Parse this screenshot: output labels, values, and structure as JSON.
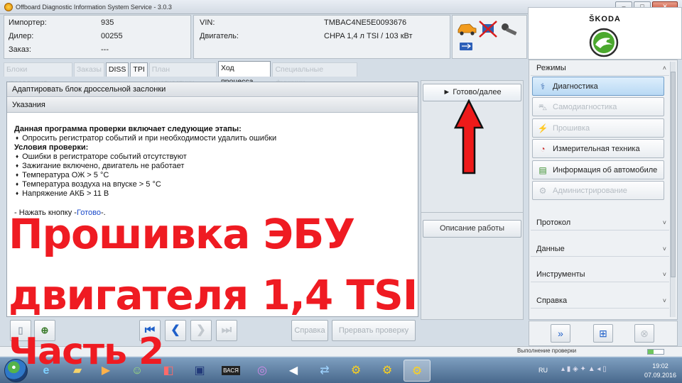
{
  "window": {
    "title": "Offboard Diagnostic Information System Service - 3.0.3"
  },
  "titlebar_buttons": {
    "minimize": "–",
    "maximize": "□",
    "close": "✕"
  },
  "vehicle_info": {
    "importer_label": "Импортер:",
    "importer_value": "935",
    "dealer_label": "Дилер:",
    "dealer_value": "00255",
    "order_label": "Заказ:",
    "order_value": "---",
    "vin_label": "VIN:",
    "vin_value": "TMBAC4NE5E0093676",
    "engine_label": "Двигатель:",
    "engine_value": "CHPA 1,4 л TSI / 103 кВт"
  },
  "brand": {
    "name": "ŠKODA"
  },
  "tabs": [
    {
      "label": "Блоки управления",
      "state": "disabled"
    },
    {
      "label": "Заказы",
      "state": "disabled"
    },
    {
      "label": "DISS",
      "state": "enabled"
    },
    {
      "label": "TPI",
      "state": "enabled"
    },
    {
      "label": "План диагностики",
      "state": "disabled"
    },
    {
      "label": "Ход процесса",
      "state": "active"
    },
    {
      "label": "Специальные функции",
      "state": "disabled"
    }
  ],
  "content": {
    "step_title": "Адаптировать блок дроссельной заслонки",
    "section_title": "Указания",
    "heading1": "Данная программа проверки включает следующие этапы:",
    "item1": "Опросить регистратор событий и при необходимости удалить ошибки",
    "heading2": "Условия проверки:",
    "conditions": [
      "Ошибки в регистраторе событий отсутствуют",
      "Зажигание включено, двигатель не работает",
      "Температура ОЖ > 5 °C",
      "Температура воздуха на впуске > 5 °C",
      "Напряжение АКБ > 11 В"
    ],
    "press_prefix": "- Нажать кнопку -",
    "press_link": "Готово",
    "press_suffix": "-."
  },
  "side_buttons": {
    "ready": "► Готово/далее",
    "work_description": "Описание работы"
  },
  "bottom_buttons": {
    "help": "Справка",
    "abort": "Прервать проверку"
  },
  "modes": {
    "header": "Режимы",
    "items": [
      {
        "label": "Диагностика",
        "icon": "stethoscope-icon",
        "state": "selected"
      },
      {
        "label": "Самодиагностика",
        "icon": "car-icon",
        "state": "disabled"
      },
      {
        "label": "Прошивка",
        "icon": "flash-icon",
        "state": "disabled"
      },
      {
        "label": "Измерительная техника",
        "icon": "gauge-icon",
        "state": "enabled"
      },
      {
        "label": "Информация об автомобиле",
        "icon": "books-icon",
        "state": "enabled"
      },
      {
        "label": "Администрирование",
        "icon": "gear-icon",
        "state": "disabled"
      }
    ]
  },
  "sections": [
    {
      "label": "Протокол"
    },
    {
      "label": "Данные"
    },
    {
      "label": "Инструменты"
    },
    {
      "label": "Справка"
    }
  ],
  "status": {
    "text": "Выполнение проверки",
    "progress": 0.35
  },
  "taskbar": {
    "lang": "RU",
    "time": "19:02",
    "date": "07.09.2016",
    "vas_label": "ВАСЯ"
  },
  "overlay": {
    "line1": "Прошивка ЭБУ",
    "line2": "двигателя 1,4 TSI",
    "line3": "Часть 2"
  },
  "colors": {
    "overlay_red": "#ef1b22",
    "arrow_red": "#ee1a1a",
    "accent_blue": "#1e5fc9",
    "skoda_green": "#4ba82e"
  }
}
